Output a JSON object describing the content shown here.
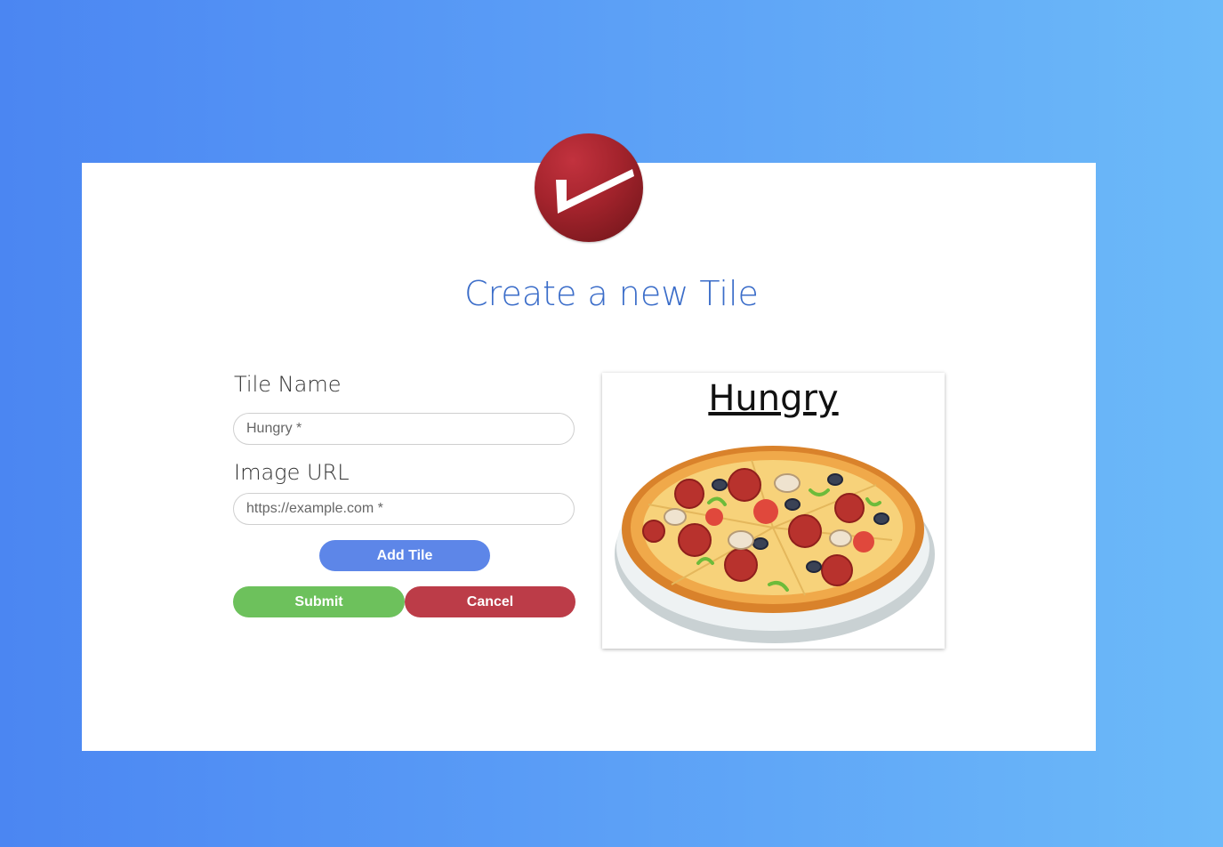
{
  "page": {
    "title": "Create a new Tile"
  },
  "logo": {
    "icon": "checkmark-icon"
  },
  "form": {
    "tile_name_label": "Tile Name",
    "tile_name_placeholder": "Hungry *",
    "tile_name_value": "",
    "image_url_label": "Image URL",
    "image_url_placeholder": "https://example.com *",
    "image_url_value": "",
    "add_tile_label": "Add Tile",
    "submit_label": "Submit",
    "cancel_label": "Cancel"
  },
  "preview": {
    "title": "Hungry",
    "image": "pizza-image"
  },
  "colors": {
    "title": "#3b6dc9",
    "add_button": "#5d86e8",
    "submit_button": "#6dc15c",
    "cancel_button": "#bc3c48",
    "logo": "#a3232c"
  }
}
